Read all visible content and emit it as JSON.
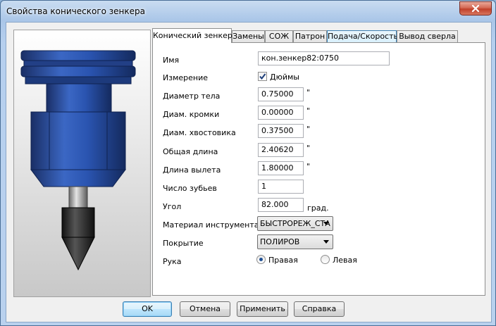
{
  "window": {
    "title": "Свойства конического зенкера"
  },
  "tabs": [
    {
      "label": "Конический зенкер"
    },
    {
      "label": "Замены"
    },
    {
      "label": "СОЖ"
    },
    {
      "label": "Патрон"
    },
    {
      "label": "Подача/Скорость"
    },
    {
      "label": "Вывод сверла"
    }
  ],
  "form": {
    "name": {
      "label": "Имя",
      "value": "кон.зенкер82:0750"
    },
    "measure": {
      "label": "Измерение",
      "checkbox_label": "Дюймы",
      "checked": true
    },
    "body_diameter": {
      "label": "Диаметр тела",
      "value": "0.75000",
      "unit": "\""
    },
    "edge_diameter": {
      "label": "Диам. кромки",
      "value": "0.00000",
      "unit": "\""
    },
    "shank_diameter": {
      "label": "Диам. хвостовика",
      "value": "0.37500",
      "unit": "\""
    },
    "total_length": {
      "label": "Общая длина",
      "value": "2.40620",
      "unit": "\""
    },
    "stickout_length": {
      "label": "Длина вылета",
      "value": "1.80000",
      "unit": "\""
    },
    "teeth": {
      "label": "Число зубьев",
      "value": "1"
    },
    "angle": {
      "label": "Угол",
      "value": "82.000",
      "unit": "град."
    },
    "material": {
      "label": "Материал инструмента",
      "value": "БЫСТРОРЕЖ_СТА"
    },
    "coating": {
      "label": "Покрытие",
      "value": "ПОЛИРОВ"
    },
    "hand": {
      "label": "Рука",
      "right": "Правая",
      "left": "Левая",
      "selected": "right"
    }
  },
  "buttons": {
    "ok": "OK",
    "cancel": "Отмена",
    "apply": "Применить",
    "help": "Справка"
  },
  "colors": {
    "tool_blue": "#1d3f8c",
    "tool_body": "#2c5ab5",
    "tip_dark": "#222222"
  }
}
